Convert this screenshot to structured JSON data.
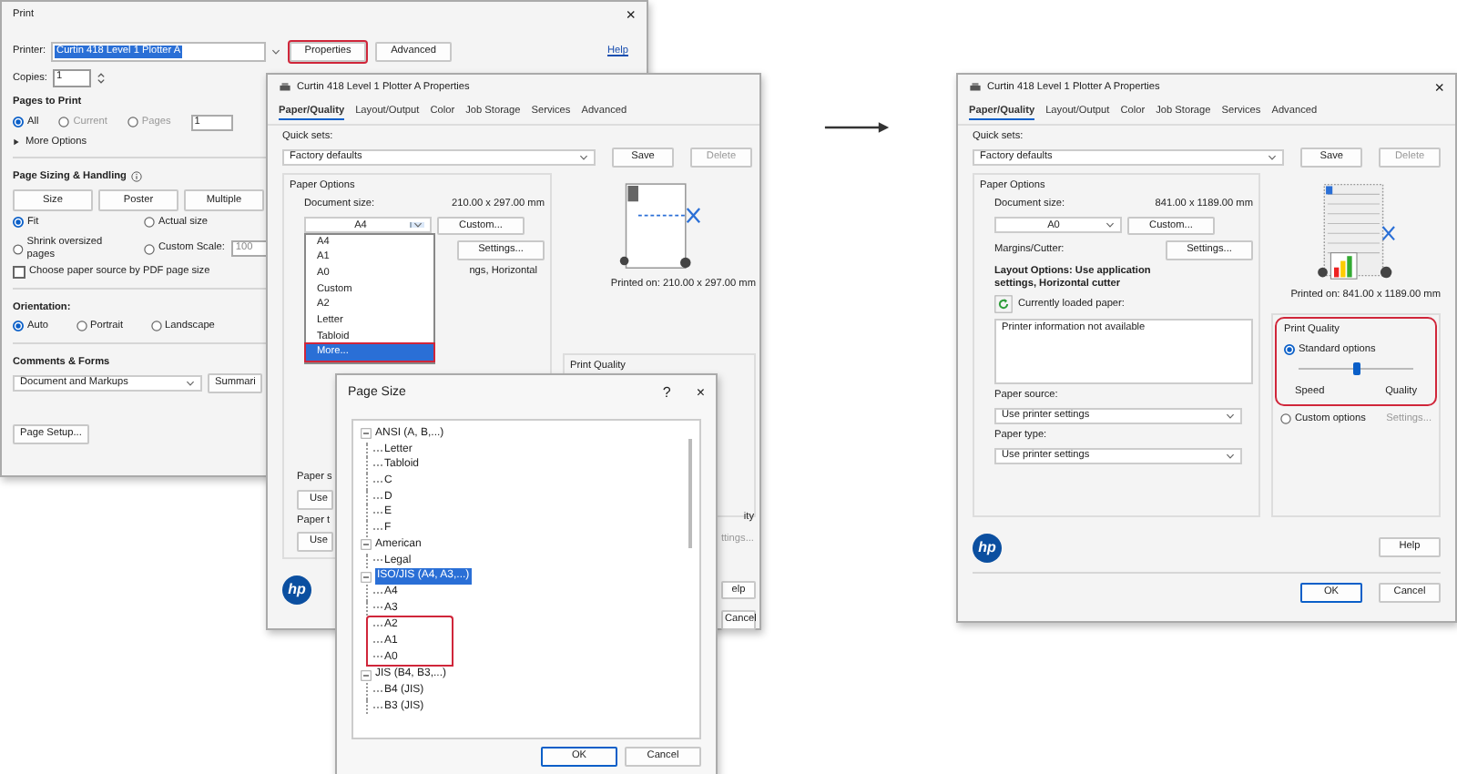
{
  "print_dialog": {
    "title": "Print",
    "close": "×",
    "printer_label": "Printer:",
    "printer": "Curtin 418 Level 1 Plotter A",
    "buttons": [
      {
        "label": "Properties",
        "highlighted": true
      },
      {
        "label": "Advanced",
        "highlighted": false
      }
    ],
    "help_link": "Help",
    "copies_label": "Copies:",
    "copies": "1",
    "pages_heading": "Pages to Print",
    "pages_options": [
      {
        "label": "All",
        "selected": true,
        "disabled": false
      },
      {
        "label": "Current",
        "selected": false,
        "disabled": true
      },
      {
        "label": "Pages",
        "selected": false,
        "disabled": true
      }
    ],
    "pages_value": "1",
    "more_options": "More Options",
    "sizing_heading": "Page Sizing & Handling",
    "sizing_buttons": [
      "Size",
      "Poster",
      "Multiple"
    ],
    "scale_options": [
      {
        "label": "Fit",
        "selected": true
      },
      {
        "label": "Actual size",
        "selected": false
      },
      {
        "label": "Shrink oversized pages",
        "selected": false
      },
      {
        "label": "Custom Scale:",
        "selected": false
      }
    ],
    "scale_value": "100",
    "paper_source_check": {
      "label": "Choose paper source by PDF page size",
      "checked": false
    },
    "orientation_heading": "Orientation:",
    "orientation_options": [
      {
        "label": "Auto",
        "selected": true
      },
      {
        "label": "Portrait",
        "selected": false
      },
      {
        "label": "Landscape",
        "selected": false
      }
    ],
    "comments_heading": "Comments & Forms",
    "comments_value": "Document and Markups",
    "summary_button": "Summari",
    "page_setup": "Page Setup..."
  },
  "properties_left": {
    "title": "Curtin 418 Level 1 Plotter A Properties",
    "tabs": [
      {
        "label": "Paper/Quality",
        "selected": true
      },
      {
        "label": "Layout/Output",
        "selected": false
      },
      {
        "label": "Color",
        "selected": false
      },
      {
        "label": "Job Storage",
        "selected": false
      },
      {
        "label": "Services",
        "selected": false
      },
      {
        "label": "Advanced",
        "selected": false
      }
    ],
    "quick_sets_label": "Quick sets:",
    "quick_set": "Factory defaults",
    "save": "Save",
    "delete": "Delete",
    "paper_options_heading": "Paper Options",
    "document_size_label": "Document size:",
    "document_size": "210.00 x 297.00 mm",
    "size_value": "A4",
    "custom": "Custom...",
    "settings": "Settings...",
    "size_list": [
      {
        "label": "A4",
        "selected": false,
        "highlighted": false
      },
      {
        "label": "A1",
        "selected": false,
        "highlighted": false
      },
      {
        "label": "A0",
        "selected": false,
        "highlighted": false
      },
      {
        "label": "Custom",
        "selected": false,
        "highlighted": false
      },
      {
        "label": "A2",
        "selected": false,
        "highlighted": false
      },
      {
        "label": "Letter",
        "selected": false,
        "highlighted": false
      },
      {
        "label": "Tabloid",
        "selected": false,
        "highlighted": false
      },
      {
        "label": "More...",
        "selected": true,
        "highlighted": true
      }
    ],
    "layout_fragment": "ngs, Horizontal",
    "printed_on": "Printed on: 210.00 x 297.00 mm",
    "print_quality_heading": "Print Quality",
    "paper_source_label": "Paper s",
    "paper_source": "Use",
    "paper_type_label": "Paper t",
    "paper_type": "Use",
    "quality_fragment": "ity",
    "settings_fragment": "ttings...",
    "logo": "hp",
    "help": "elp",
    "cancel": "Cancel"
  },
  "page_size_dialog": {
    "title": "Page Size",
    "help": "?",
    "close": "×",
    "tree": [
      {
        "label": "ANSI (A, B,...)",
        "expanded": true,
        "selected": false,
        "children": [
          {
            "label": "Letter",
            "selected": false,
            "highlighted": false
          },
          {
            "label": "Tabloid",
            "selected": false,
            "highlighted": false
          },
          {
            "label": "C",
            "selected": false,
            "highlighted": false
          },
          {
            "label": "D",
            "selected": false,
            "highlighted": false
          },
          {
            "label": "E",
            "selected": false,
            "highlighted": false
          },
          {
            "label": "F",
            "selected": false,
            "highlighted": false
          }
        ]
      },
      {
        "label": "American",
        "expanded": true,
        "selected": false,
        "children": [
          {
            "label": "Legal",
            "selected": false,
            "highlighted": false
          }
        ]
      },
      {
        "label": "ISO/JIS (A4, A3,...)",
        "expanded": true,
        "selected": true,
        "children": [
          {
            "label": "A4",
            "selected": false,
            "highlighted": false
          },
          {
            "label": "A3",
            "selected": false,
            "highlighted": false
          },
          {
            "label": "A2",
            "selected": false,
            "highlighted": true
          },
          {
            "label": "A1",
            "selected": false,
            "highlighted": true
          },
          {
            "label": "A0",
            "selected": false,
            "highlighted": true
          }
        ]
      },
      {
        "label": "JIS (B4, B3,...)",
        "expanded": true,
        "selected": false,
        "children": [
          {
            "label": "B4 (JIS)",
            "selected": false,
            "highlighted": false
          },
          {
            "label": "B3 (JIS)",
            "selected": false,
            "highlighted": false
          }
        ]
      }
    ],
    "ok": "OK",
    "cancel": "Cancel"
  },
  "properties_right": {
    "title": "Curtin 418 Level 1 Plotter A Properties",
    "close": "×",
    "tabs": [
      {
        "label": "Paper/Quality",
        "selected": true
      },
      {
        "label": "Layout/Output",
        "selected": false
      },
      {
        "label": "Color",
        "selected": false
      },
      {
        "label": "Job Storage",
        "selected": false
      },
      {
        "label": "Services",
        "selected": false
      },
      {
        "label": "Advanced",
        "selected": false
      }
    ],
    "quick_sets_label": "Quick sets:",
    "quick_set": "Factory defaults",
    "save": "Save",
    "delete": "Delete",
    "paper_options_heading": "Paper Options",
    "document_size_label": "Document size:",
    "document_size": "841.00 x 1189.00 mm",
    "size_value": "A0",
    "custom": "Custom...",
    "margins_label": "Margins/Cutter:",
    "settings": "Settings...",
    "layout_options": "Layout Options: Use application settings, Horizontal cutter",
    "loaded_paper_label": "Currently loaded paper:",
    "loaded_paper": "Printer information not available",
    "paper_source_label": "Paper source:",
    "paper_source": "Use printer settings",
    "paper_type_label": "Paper type:",
    "paper_type": "Use printer settings",
    "printed_on": "Printed on: 841.00 x 1189.00 mm",
    "print_quality": {
      "heading": "Print Quality",
      "highlighted": true,
      "standard": {
        "label": "Standard options",
        "selected": true
      },
      "level": 0.5,
      "speed": "Speed",
      "quality": "Quality"
    },
    "custom_options": {
      "label": "Custom options",
      "selected": false
    },
    "custom_settings": "Settings...",
    "logo": "hp",
    "help": "Help",
    "ok": "OK",
    "cancel": "Cancel"
  }
}
